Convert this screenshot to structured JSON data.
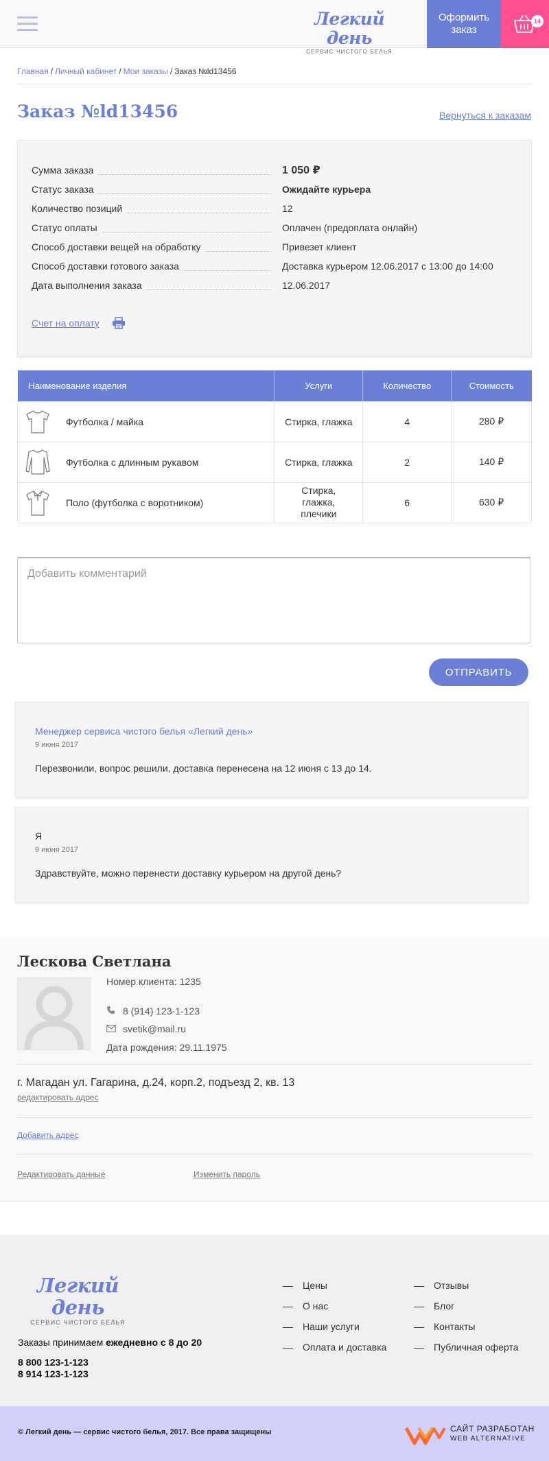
{
  "header": {
    "logo_title": "Легкий день",
    "logo_subtitle": "сервис чистого белья",
    "order_button": "Оформить заказ",
    "cart_count": "14"
  },
  "breadcrumb": {
    "items": [
      "Главная",
      "Личный кабинет",
      "Мои заказы"
    ],
    "current": "Заказ №ld13456"
  },
  "page": {
    "title": "Заказ №ld13456",
    "back_link": "Вернуться к заказам"
  },
  "order_info": {
    "rows": [
      {
        "label": "Сумма заказа",
        "value": "1 050 ₽"
      },
      {
        "label": "Статус заказа",
        "value": "Ожидайте курьера"
      },
      {
        "label": "Количество позиций",
        "value": "12"
      },
      {
        "label": "Статус оплаты",
        "value": "Оплачен (предоплата онлайн)"
      },
      {
        "label": "Способ доставки вещей на обработку",
        "value": "Привезет клиент"
      },
      {
        "label": "Способ доставки готового заказа",
        "value": "Доставка курьером 12.06.2017 с 13:00 до 14:00"
      },
      {
        "label": "Дата выполнения заказа",
        "value": "12.06.2017"
      }
    ],
    "invoice_link": "Счет на оплату"
  },
  "items_table": {
    "headers": [
      "Наименование изделия",
      "Услуги",
      "Количество",
      "Стоимость"
    ],
    "rows": [
      {
        "icon": "tshirt-icon",
        "name": "Футболка / майка",
        "services": "Стирка, глажка",
        "qty": "4",
        "price": "280 ₽"
      },
      {
        "icon": "long-sleeve-icon",
        "name": "Футболка с длинным рукавом",
        "services": "Стирка, глажка",
        "qty": "2",
        "price": "140 ₽"
      },
      {
        "icon": "polo-icon",
        "name": "Поло (футболка с воротником)",
        "services": "Стирка, глажка, плечики",
        "qty": "6",
        "price": "630 ₽"
      }
    ]
  },
  "comment": {
    "placeholder": "Добавить комментарий",
    "send_button": "ОТПРАВИТЬ"
  },
  "messages": [
    {
      "author": "Менеджер сервиса чистого белья «Легкий день»",
      "date": "9 июня 2017",
      "text": "Перезвонили, вопрос решили, доставка перенесена на 12 июня с 13 до 14."
    },
    {
      "author": "Я",
      "date": "9 июня 2017",
      "text": "Здравствуйте, можно перенести доставку курьером на другой день?"
    }
  ],
  "profile": {
    "name": "Лескова Светлана",
    "client_number": "Номер клиента: 1235",
    "phone": "8 (914) 123-1-123",
    "email": "svetik@mail.ru",
    "birthdate": "Дата рождения: 29.11.1975",
    "address": "г. Магадан ул. Гагарина, д.24, корп.2, подъезд 2, кв. 13",
    "edit_address": "редактировать адрес",
    "add_address": "Добавить адрес",
    "edit_data": "Редактировать данные",
    "change_password": "Изменить пароль"
  },
  "footer": {
    "logo_title": "Легкий день",
    "logo_subtitle": "сервис чистого белья",
    "orders_prefix": "Заказы  принимаем ",
    "orders_hours": "ежедневно с 8 до 20",
    "phones": [
      "8 800 123-1-123",
      "8 914  123-1-123"
    ],
    "menu_col1": [
      "Цены",
      "О нас",
      "Наши услуги",
      "Оплата и доставка"
    ],
    "menu_col2": [
      "Отзывы",
      "Блог",
      "Контакты",
      "Публичная оферта"
    ],
    "copyright": "© Легкий день — сервис чистого белья, 2017. Все права защищены",
    "developer_line1": "САЙТ РАЗРАБОТАН",
    "developer_line2": "WEB ALTERNATIVE"
  },
  "colors": {
    "accent": "#6b7fd7",
    "cart": "#ff4f8f",
    "copyright_bar": "#d0d0fb",
    "developer_logo": "#ff6a2b"
  }
}
